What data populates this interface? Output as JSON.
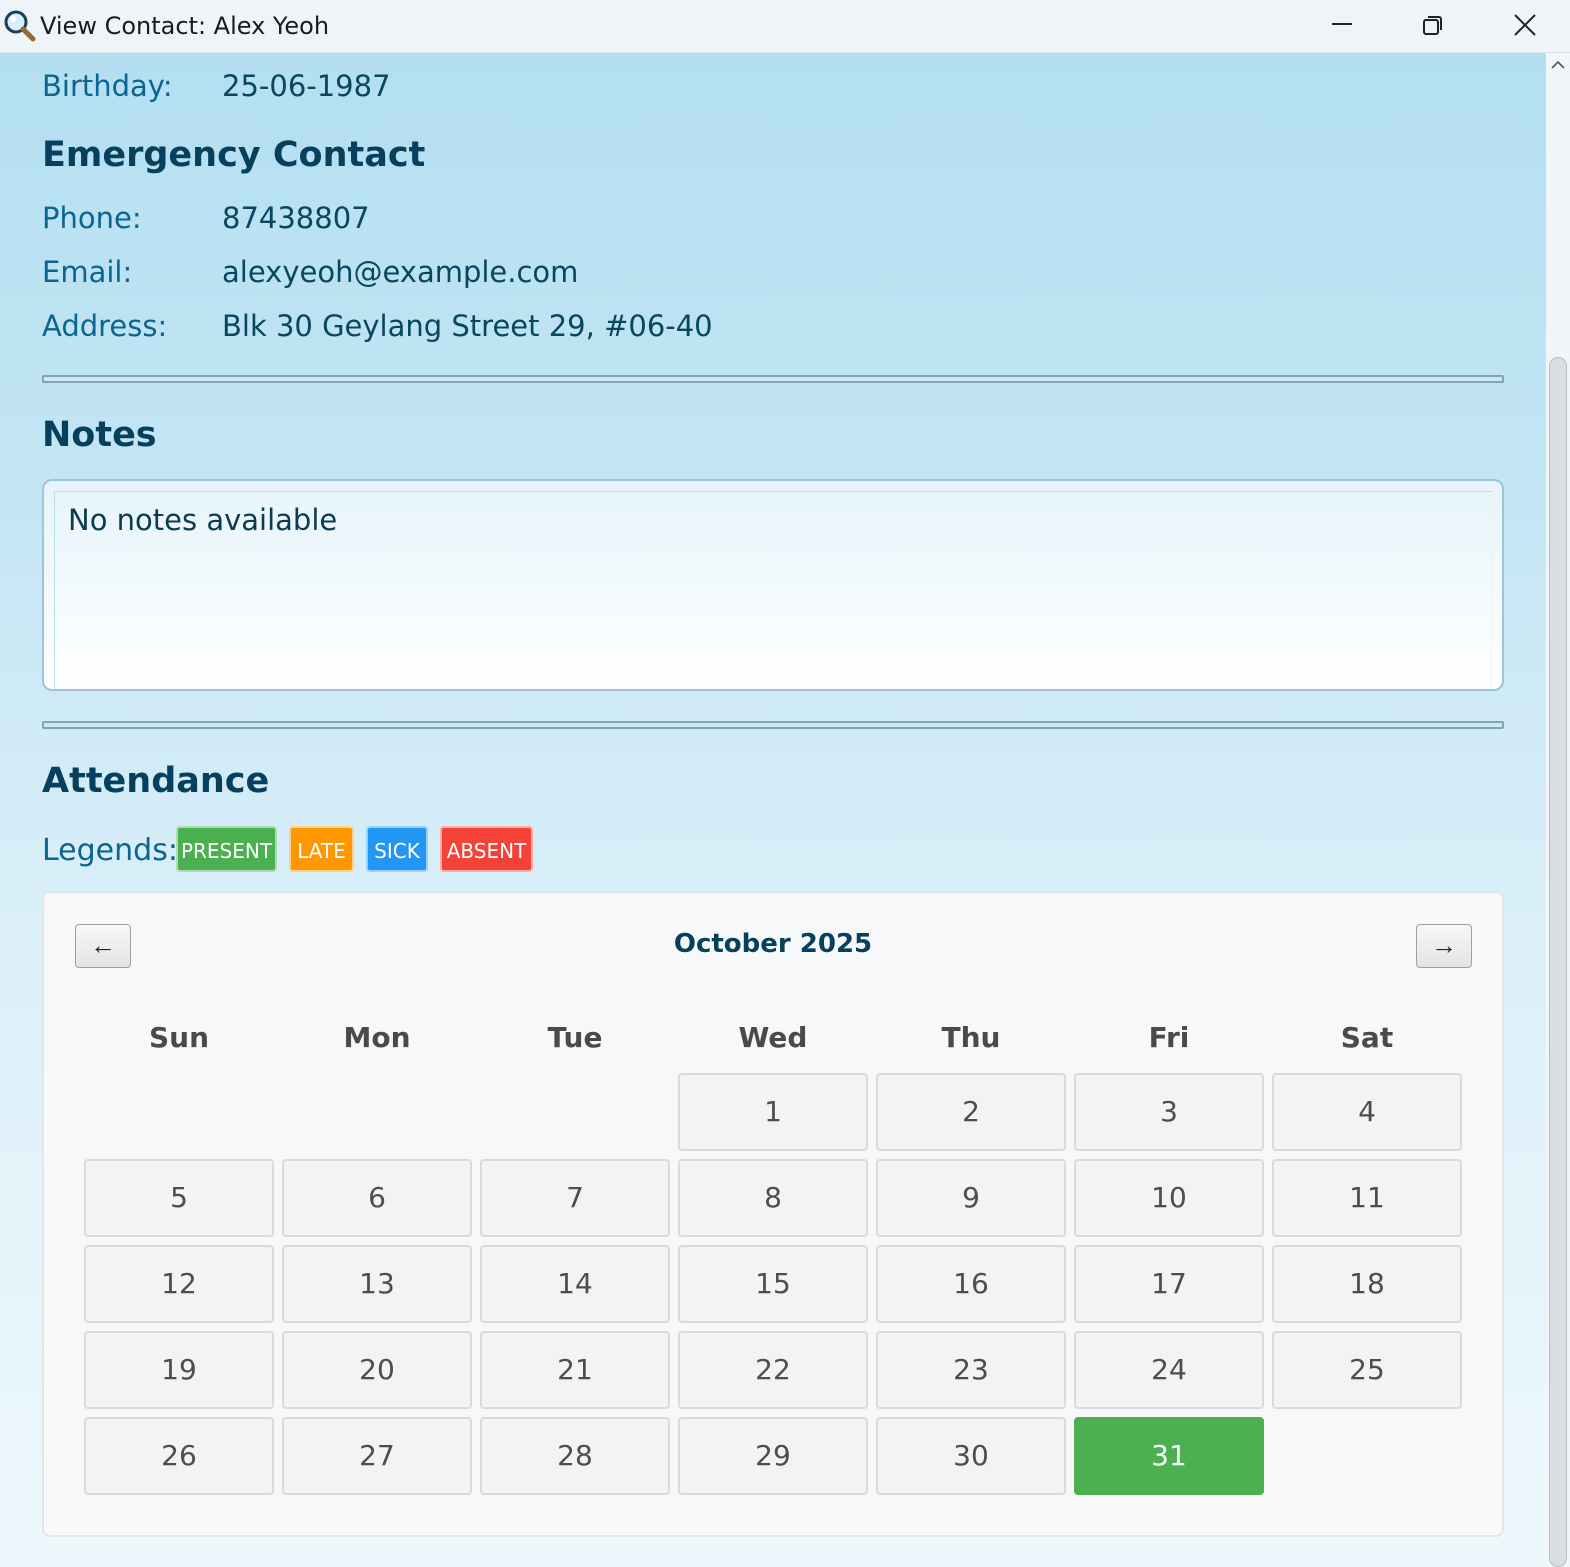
{
  "window": {
    "title": "View Contact: Alex Yeoh"
  },
  "personal": {
    "birthday_label": "Birthday:",
    "birthday_value": "25-06-1987"
  },
  "emergency": {
    "heading": "Emergency Contact",
    "phone_label": "Phone:",
    "phone_value": "87438807",
    "email_label": "Email:",
    "email_value": "alexyeoh@example.com",
    "address_label": "Address:",
    "address_value": "Blk 30 Geylang Street 29, #06-40"
  },
  "notes": {
    "heading": "Notes",
    "text": "No notes available"
  },
  "attendance": {
    "heading": "Attendance",
    "legend_label": "Legends:",
    "legends": [
      {
        "label": "PRESENT",
        "color": "#4caf50"
      },
      {
        "label": "LATE",
        "color": "#ff9800"
      },
      {
        "label": "SICK",
        "color": "#2196f3"
      },
      {
        "label": "ABSENT",
        "color": "#f44336"
      }
    ]
  },
  "calendar": {
    "prev_label": "←",
    "next_label": "→",
    "month_title": "October 2025",
    "weekdays": [
      "Sun",
      "Mon",
      "Tue",
      "Wed",
      "Thu",
      "Fri",
      "Sat"
    ],
    "first_weekday_index": 3,
    "days_in_month": 31,
    "days": [
      "1",
      "2",
      "3",
      "4",
      "5",
      "6",
      "7",
      "8",
      "9",
      "10",
      "11",
      "12",
      "13",
      "14",
      "15",
      "16",
      "17",
      "18",
      "19",
      "20",
      "21",
      "22",
      "23",
      "24",
      "25",
      "26",
      "27",
      "28",
      "29",
      "30",
      "31"
    ],
    "marked": [
      {
        "day": 31,
        "status": "PRESENT"
      }
    ]
  },
  "icons": {
    "app": "magnifier-icon",
    "minimize": "minimize-icon",
    "maximize": "restore-icon",
    "close": "close-icon",
    "scroll_up": "chevron-up-icon"
  }
}
